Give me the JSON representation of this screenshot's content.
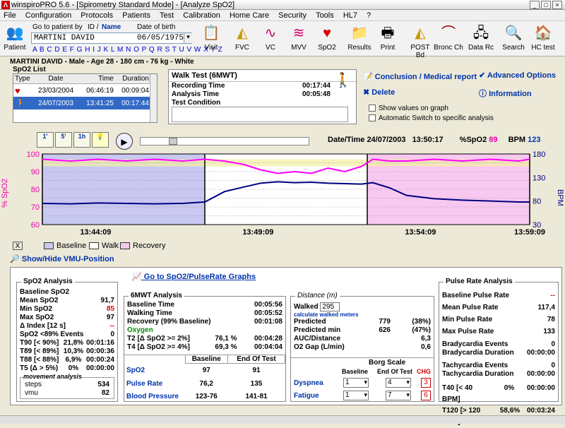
{
  "window": {
    "title": "winspiroPRO 5.6 - [Spirometry Standard Mode] - [Analyze SpO2]",
    "icon_letter": "Λ"
  },
  "menu": [
    "File",
    "Configuration",
    "Protocols",
    "Patients",
    "Test",
    "Calibration",
    "Home Care",
    "Security",
    "Tools",
    "HL7",
    "?"
  ],
  "toolbar": {
    "patient_label": "Patient",
    "go_to_patient": "Go to patient by",
    "id_label": "ID /",
    "name_label": "Name",
    "dob_label": "Date of birth",
    "patient_value": "MARTINI DAVID",
    "dob_value": "06/05/1975",
    "alphabet": "A B C D E F G H I J K L M N O P Q R S T U V W X Y Z",
    "buttons": [
      "Visit",
      "FVC",
      "VC",
      "MVV",
      "SpO2",
      "Results",
      "Print",
      "POST Bd",
      "Bronc Ch",
      "Data Rc",
      "Search",
      "HC test"
    ]
  },
  "subject": "MARTINI DAVID - Male - Age 28 - 180 cm - 76 kg - White",
  "spo2_list": {
    "title": "SpO2 List",
    "headers": [
      "Type",
      "Date",
      "Time",
      "Duration"
    ],
    "rows": [
      [
        "23/03/2004",
        "06:46:19",
        "00:09:04"
      ],
      [
        "24/07/2003",
        "13:41:25",
        "00:17:44"
      ]
    ]
  },
  "walk_test": {
    "title": "Walk Test (6MWT)",
    "recording_label": "Recording Time",
    "recording_value": "00:17:44",
    "analysis_label": "Analysis Time",
    "analysis_value": "00:05:48",
    "condition_label": "Test Condition"
  },
  "actions": {
    "conclusion": "Conclusion / Medical report",
    "delete": "Delete",
    "advanced": "Advanced Options",
    "information": "Information",
    "show_values": "Show values on graph",
    "auto_switch": "Automatic Switch to specific analysis"
  },
  "graph_controls": {
    "b1": "1'",
    "b5": "5'",
    "b1h": "1h",
    "date_label": "Date/Time",
    "date": "24/07/2003",
    "time": "13:50:17",
    "spo2_label": "%SpO2",
    "spo2": "89",
    "bpm_label": "BPM",
    "bpm": "123"
  },
  "chart_data": {
    "type": "line",
    "y_left_label": "% SpO2",
    "y_left_range": [
      60,
      100
    ],
    "y_left_ticks": [
      "100",
      "90",
      "80",
      "70",
      "60"
    ],
    "y_right_label": "BPM",
    "y_right_range": [
      30,
      180
    ],
    "y_right_ticks": [
      "180",
      "130",
      "80",
      "30"
    ],
    "x_ticks": [
      "13:44:09",
      "13:49:09",
      "13:54:09",
      "13:59:09"
    ],
    "phases": [
      {
        "name": "Baseline",
        "from": 0,
        "to": 5.8,
        "color": "#c8c8f0"
      },
      {
        "name": "Walk",
        "from": 5.8,
        "to": 11.6,
        "color": "#ffffff"
      },
      {
        "name": "Recovery",
        "from": 11.6,
        "to": 17.4,
        "color": "#f8c8f0"
      }
    ],
    "series": [
      {
        "axis": "left",
        "color": "#ff00ff",
        "x": [
          0,
          1,
          2,
          3,
          4,
          5,
          5.8,
          6.5,
          7.2,
          7.8,
          8.4,
          9,
          9.6,
          10.2,
          10.8,
          11.4,
          11.8,
          12.4,
          13,
          14,
          15,
          16,
          17,
          17.4
        ],
        "values": [
          97,
          96,
          97,
          96,
          97,
          96,
          97,
          96,
          94,
          91,
          89,
          90,
          89,
          92,
          90,
          93,
          97,
          96,
          96,
          97,
          96,
          97,
          96,
          97
        ]
      },
      {
        "axis": "right",
        "color": "#000080",
        "x": [
          0,
          1,
          2,
          3,
          4,
          5,
          5.8,
          6.5,
          7.2,
          7.8,
          8.4,
          9,
          9.6,
          10.2,
          10.8,
          11.4,
          11.8,
          12.4,
          13,
          14,
          15,
          16,
          17,
          17.4
        ],
        "values": [
          75,
          74,
          76,
          75,
          74,
          75,
          78,
          100,
          110,
          118,
          121,
          119,
          120,
          118,
          117,
          116,
          119,
          108,
          92,
          85,
          82,
          80,
          78,
          78
        ]
      }
    ]
  },
  "legend": {
    "baseline": "Baseline",
    "walk": "Walk",
    "recovery": "Recovery",
    "close": "X"
  },
  "show_hide": "Show/Hide VMU-Position",
  "goto_graphs": "Go to SpO2/PulseRate Graphs",
  "spo2_analysis": {
    "title": "SpO2 Analysis",
    "rows": [
      [
        "Baseline SpO2",
        ""
      ],
      [
        "Mean SpO2",
        "91,7"
      ],
      [
        "Min SpO2",
        "85"
      ],
      [
        "Max SpO2",
        "97"
      ],
      [
        "Δ Index [12 s]",
        "--"
      ],
      [
        "SpO2 <89% Events",
        "0"
      ]
    ],
    "t_rows": [
      [
        "T90 [< 90%]",
        "21,8%",
        "00:01:16"
      ],
      [
        "T89 [< 89%]",
        "10,3%",
        "00:00:36"
      ],
      [
        "T88 [< 88%]",
        "6,9%",
        "00:00:24"
      ],
      [
        "T5 (Δ > 5%)",
        "0%",
        "00:00:00"
      ]
    ],
    "movement_title": "movement analysis",
    "steps_label": "steps",
    "steps": "534",
    "vmu_label": "vmu",
    "vmu": "82"
  },
  "mwt_analysis": {
    "title": "6MWT Analysis",
    "rows": [
      [
        "Baseline Time",
        "00:05:56"
      ],
      [
        "Walking Time",
        "00:05:52"
      ],
      [
        "Recovery (99% Baseline)",
        "00:01:08"
      ]
    ],
    "oxygen": "Oxygen",
    "t_rows": [
      [
        "T2 [Δ SpO2 >= 2%]",
        "76,1 %",
        "00:04:28"
      ],
      [
        "T4 [Δ SpO2 >= 4%]",
        "69,3 %",
        "00:04:04"
      ]
    ],
    "table_headers": [
      "Baseline",
      "End Of Test"
    ],
    "table_rows": [
      [
        "SpO2",
        "97",
        "91"
      ],
      [
        "Pulse Rate",
        "76,2",
        "135"
      ],
      [
        "Blood Pressure",
        "123-76",
        "141-81"
      ]
    ]
  },
  "distance": {
    "title": "Distance (m)",
    "walked_label": "Walked",
    "walked": "295",
    "calc": "calculate walked meters",
    "rows": [
      [
        "Predicted",
        "779",
        "(38%)"
      ],
      [
        "Predicted min",
        "626",
        "(47%)"
      ],
      [
        "AUC/Distance",
        "",
        "6,3"
      ],
      [
        "O2 Gap (L/min)",
        "",
        "0,6"
      ]
    ],
    "borg_title": "Borg Scale",
    "borg_headers": [
      "Baseline",
      "End Of Test",
      "CHG"
    ],
    "borg_rows": [
      [
        "Dyspnea",
        "1",
        "4",
        "3"
      ],
      [
        "Fatigue",
        "1",
        "7",
        "6"
      ]
    ]
  },
  "pulse_analysis": {
    "title": "Pulse Rate Analysis",
    "rows": [
      [
        "Baseline Pulse Rate",
        "--"
      ],
      [
        "Mean Pulse Rate",
        "117,4"
      ],
      [
        "Min Pulse Rate",
        "78"
      ],
      [
        "Max Pulse Rate",
        "133"
      ],
      [
        "Bradycardia Events",
        "0"
      ],
      [
        "Bradycardia Duration",
        "00:00:00"
      ],
      [
        "Tachycardia Events",
        "0"
      ],
      [
        "Tachycardia Duration",
        "00:00:00"
      ]
    ],
    "t40_label": "T40 [< 40 BPM]",
    "t40_pct": "0%",
    "t40_time": "00:00:00",
    "t120_label": "T120 [> 120 BPM]",
    "t120_pct": "58,6%",
    "t120_time": "00:03:24"
  }
}
